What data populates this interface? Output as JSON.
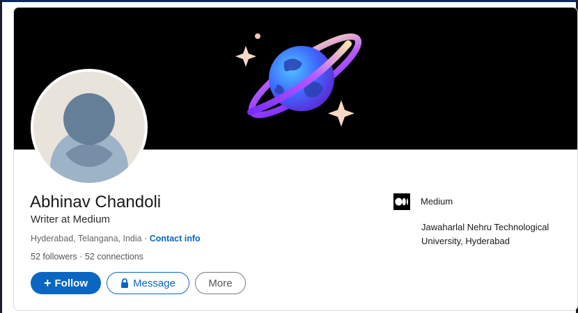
{
  "profile": {
    "name": "Abhinav Chandoli",
    "headline": "Writer at Medium",
    "location": "Hyderabad, Telangana, India",
    "separator": " · ",
    "contact_label": "Contact info",
    "followers": "52 followers",
    "stats_separator": " · ",
    "connections": "52 connections"
  },
  "actions": {
    "follow_label": "Follow",
    "message_label": "Message",
    "more_label": "More"
  },
  "experience": {
    "company_name": "Medium",
    "school_name": "Jawaharlal Nehru Technological University, Hyderabad"
  },
  "colors": {
    "accent": "#0a66c2",
    "banner": "#000000"
  },
  "icons": [
    "planet-illustration",
    "sparkle-icon",
    "default-avatar-icon",
    "plus-icon",
    "lock-icon",
    "medium-logo-icon"
  ]
}
